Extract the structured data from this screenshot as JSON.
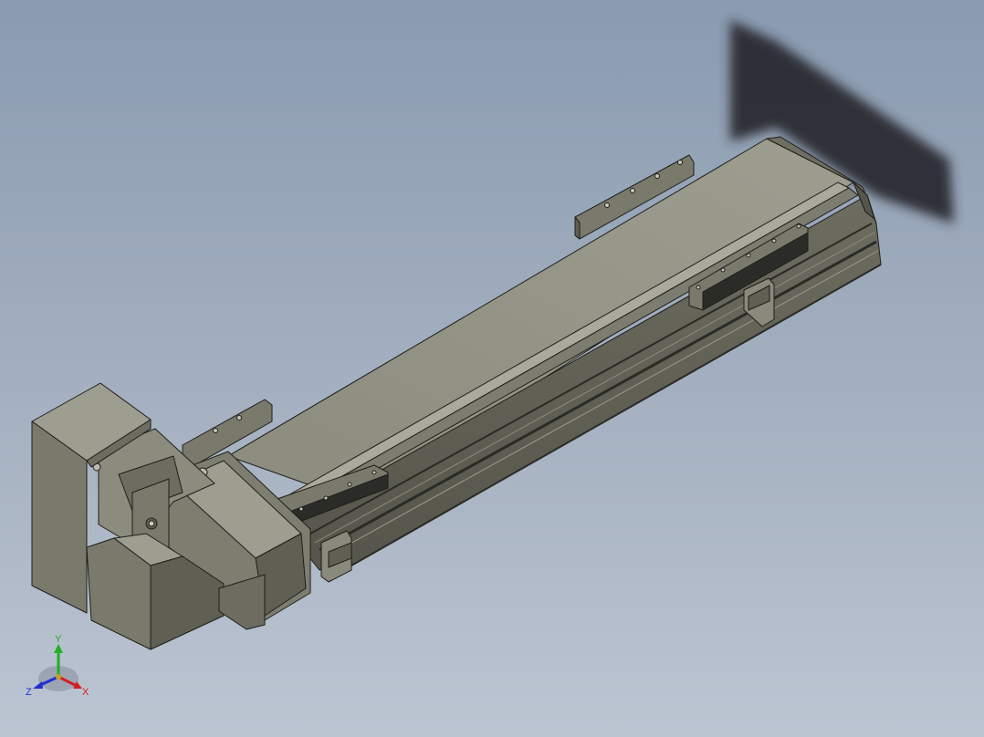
{
  "triad": {
    "x_label": "X",
    "y_label": "Y",
    "z_label": "Z",
    "x_color": "#d42020",
    "y_color": "#20b020",
    "z_color": "#2030d0"
  },
  "colors": {
    "part_face_light": "#9a9a8c",
    "part_face_mid": "#7e7e70",
    "part_face_dark": "#5f5f54",
    "edge": "#1e1e1a",
    "shadow": "#2a2c30"
  }
}
